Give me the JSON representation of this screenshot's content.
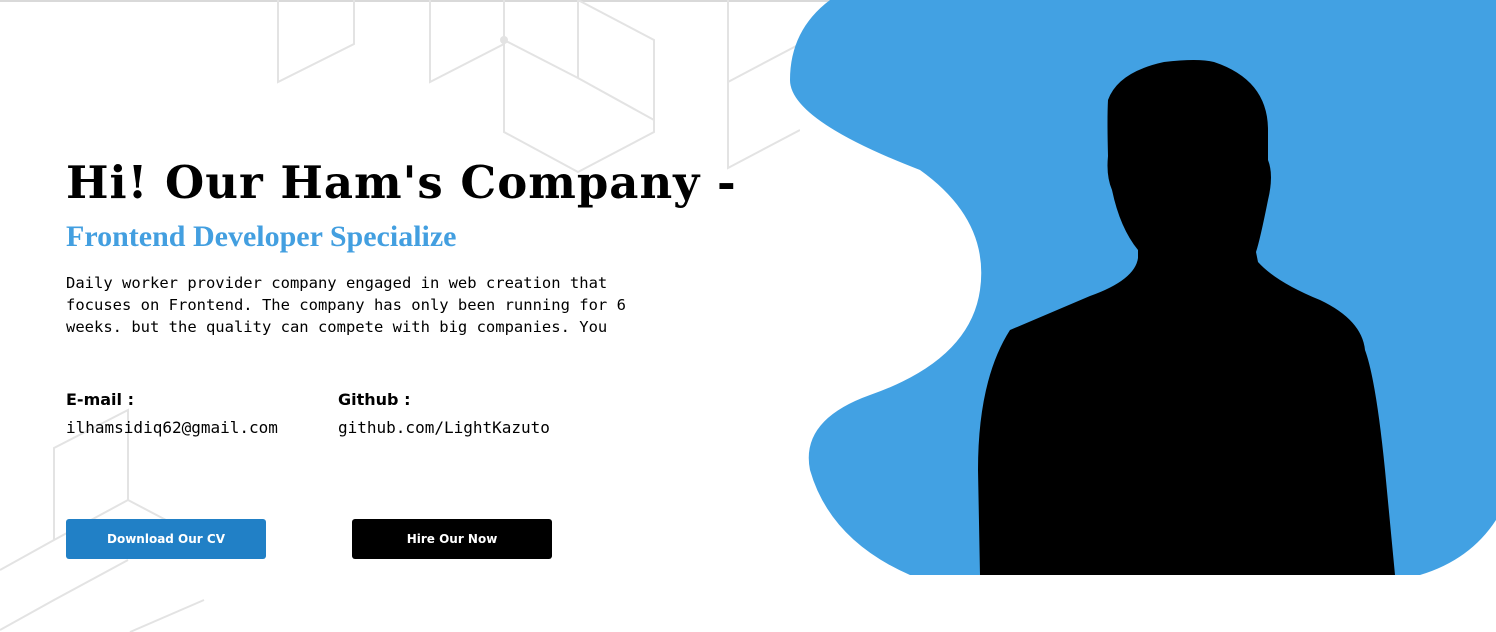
{
  "hero": {
    "title": "Hi! Our Ham's Company -",
    "subtitle": "Frontend Developer Specialize",
    "description": "Daily worker provider company engaged in web creation that focuses on Frontend. The company has only been running for 6 weeks. but the quality can compete with big companies. You"
  },
  "contact": {
    "email_label": "E-mail :",
    "email_value": "ilhamsidiq62@gmail.com",
    "github_label": "Github :",
    "github_value": "github.com/LightKazuto"
  },
  "buttons": {
    "download_cv": "Download Our CV",
    "hire": "Hire Our Now"
  },
  "colors": {
    "accent_blue": "#439fe0",
    "button_blue": "#2180c6",
    "button_dark": "#000000",
    "silhouette": "#000000"
  },
  "images": {
    "hero_portrait": "person-silhouette",
    "background": "hexagon-line-pattern"
  }
}
